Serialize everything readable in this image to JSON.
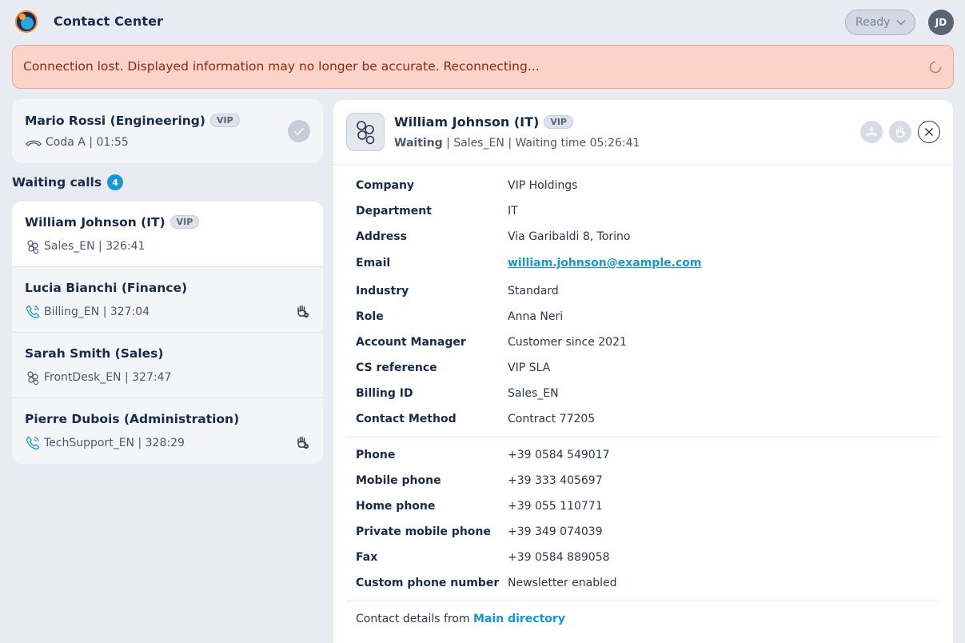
{
  "app": {
    "title": "Contact Center",
    "status": "Ready",
    "user_initials": "JD"
  },
  "banner": {
    "message": "Connection lost. Displayed information may no longer be accurate. Reconnecting..."
  },
  "active_call": {
    "name": "Mario Rossi (Engineering)",
    "badge": "VIP",
    "detail": "Coda A | 01:55"
  },
  "waiting": {
    "title": "Waiting calls",
    "count": "4",
    "items": [
      {
        "name": "William Johnson (IT)",
        "badge": "VIP",
        "detail": "Sales_EN | 326:41",
        "icon": "group-icon"
      },
      {
        "name": "Lucia Bianchi (Finance)",
        "badge": "",
        "detail": "Billing_EN | 327:04",
        "icon": "phone-icon"
      },
      {
        "name": "Sarah Smith (Sales)",
        "badge": "",
        "detail": "FrontDesk_EN | 327:47",
        "icon": "group-icon"
      },
      {
        "name": "Pierre Dubois (Administration)",
        "badge": "",
        "detail": "TechSupport_EN | 328:29",
        "icon": "phone-icon"
      }
    ]
  },
  "detail": {
    "name": "William Johnson (IT)",
    "badge": "VIP",
    "state": "Waiting",
    "info": " | Sales_EN | Waiting time 05:26:41",
    "fields": [
      {
        "label": "Company",
        "value": "VIP Holdings"
      },
      {
        "label": "Department",
        "value": "IT"
      },
      {
        "label": "Address",
        "value": "Via Garibaldi 8, Torino"
      },
      {
        "label": "Email",
        "value": "william.johnson@example.com"
      },
      {
        "label": "Industry",
        "value": "Standard"
      },
      {
        "label": "Role",
        "value": "Anna Neri"
      },
      {
        "label": "Account Manager",
        "value": "Customer since 2021"
      },
      {
        "label": "CS reference",
        "value": "VIP SLA"
      },
      {
        "label": "Billing ID",
        "value": "Sales_EN"
      },
      {
        "label": "Contact Method",
        "value": "Contract 77205"
      }
    ],
    "phones": [
      {
        "label": "Phone",
        "value": "+39 0584 549017"
      },
      {
        "label": "Mobile phone",
        "value": "+39 333 405697"
      },
      {
        "label": "Home phone",
        "value": "+39 055 110771"
      },
      {
        "label": "Private mobile phone",
        "value": "+39 349 074039"
      },
      {
        "label": "Fax",
        "value": "+39 0584 889058"
      },
      {
        "label": "Custom phone number",
        "value": "Newsletter enabled"
      }
    ],
    "footer_prefix": "Contact details from ",
    "footer_link": "Main directory"
  },
  "colors": {
    "accent": "#1597d0",
    "banner_bg": "#fcd3c9",
    "banner_text": "#8a2a12"
  }
}
